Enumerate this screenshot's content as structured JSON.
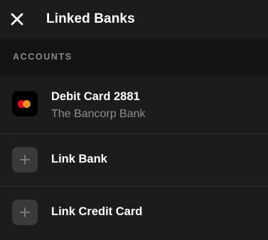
{
  "header": {
    "title": "Linked Banks",
    "close_icon": "close-icon"
  },
  "section": {
    "label": "ACCOUNTS"
  },
  "accounts": [
    {
      "title": "Debit Card 2881",
      "subtitle": "The Bancorp Bank",
      "icon": "mastercard-icon"
    }
  ],
  "actions": [
    {
      "label": "Link Bank",
      "icon": "plus-icon"
    },
    {
      "label": "Link Credit Card",
      "icon": "plus-icon"
    }
  ],
  "colors": {
    "background": "#1a1a1a",
    "row_background": "#1c1c1c",
    "section_background": "#141414",
    "text_primary": "#ffffff",
    "text_secondary": "#8e8e8e",
    "mastercard_red": "#eb001b",
    "mastercard_orange": "#f79e1b"
  }
}
